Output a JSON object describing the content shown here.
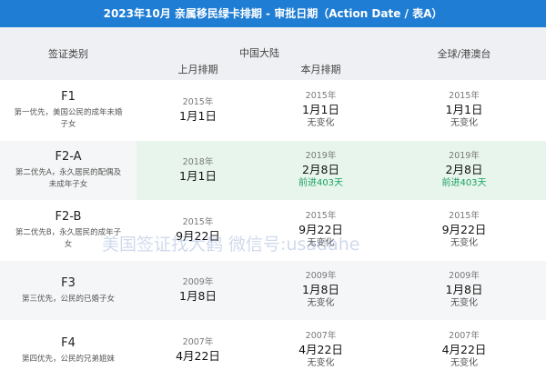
{
  "banner": "2023年10月 亲属移民绿卡排期 - 审批日期（Action Date / 表A）",
  "header": {
    "category": "签证类别",
    "mainland": "中国大陆",
    "last_month": "上月排期",
    "this_month": "本月排期",
    "global": "全球/港澳台"
  },
  "rows": [
    {
      "code": "F1",
      "desc": "第一优先，美国公民的成年未婚子女",
      "last_year": "2015年",
      "last_date": "1月1日",
      "cur_year": "2015年",
      "cur_date": "1月1日",
      "cur_note": "无变化",
      "glob_year": "2015年",
      "glob_date": "1月1日",
      "glob_note": "无变化"
    },
    {
      "code": "F2-A",
      "desc": "第二优先A，永久居民的配偶及未成年子女",
      "last_year": "2018年",
      "last_date": "1月1日",
      "cur_year": "2019年",
      "cur_date": "2月8日",
      "cur_note": "前进403天",
      "glob_year": "2019年",
      "glob_date": "2月8日",
      "glob_note": "前进403天"
    },
    {
      "code": "F2-B",
      "desc": "第二优先B，永久居民的成年子女",
      "last_year": "2015年",
      "last_date": "9月22日",
      "cur_year": "2015年",
      "cur_date": "9月22日",
      "cur_note": "无变化",
      "glob_year": "2015年",
      "glob_date": "9月22日",
      "glob_note": "无变化"
    },
    {
      "code": "F3",
      "desc": "第三优先，公民的已婚子女",
      "last_year": "2009年",
      "last_date": "1月8日",
      "cur_year": "2009年",
      "cur_date": "1月8日",
      "cur_note": "无变化",
      "glob_year": "2009年",
      "glob_date": "1月8日",
      "glob_note": "无变化"
    },
    {
      "code": "F4",
      "desc": "第四优先，公民的兄弟姐妹",
      "last_year": "2007年",
      "last_date": "4月22日",
      "cur_year": "2007年",
      "cur_date": "4月22日",
      "cur_note": "无变化",
      "glob_year": "2007年",
      "glob_date": "4月22日",
      "glob_note": "无变化"
    }
  ],
  "watermark": "美国签证找大鹤 微信号:usadahe",
  "colors": {
    "banner": "#1f7dd3",
    "advance": "#1aa260",
    "highlight": "#e8f5ec"
  }
}
